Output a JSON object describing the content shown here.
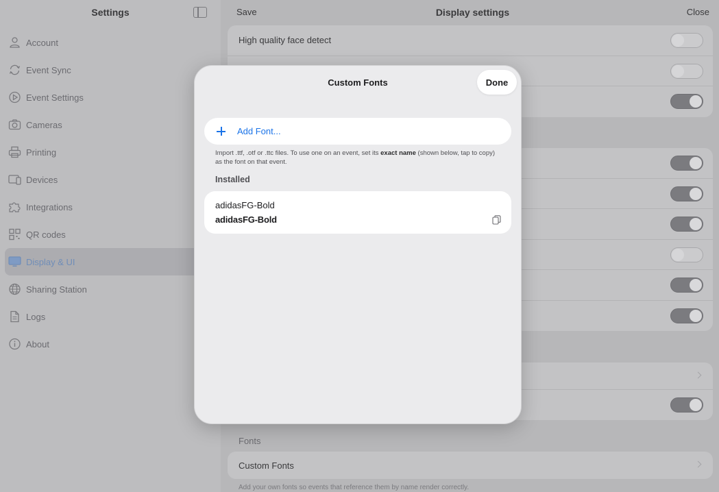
{
  "sidebar": {
    "title": "Settings",
    "items": [
      {
        "label": "Account",
        "icon": "person-icon"
      },
      {
        "label": "Event Sync",
        "icon": "sync-icon"
      },
      {
        "label": "Event Settings",
        "icon": "play-circle-icon"
      },
      {
        "label": "Cameras",
        "icon": "camera-icon"
      },
      {
        "label": "Printing",
        "icon": "printer-icon"
      },
      {
        "label": "Devices",
        "icon": "devices-icon"
      },
      {
        "label": "Integrations",
        "icon": "puzzle-icon"
      },
      {
        "label": "QR codes",
        "icon": "qr-code-icon"
      },
      {
        "label": "Display & UI",
        "icon": "display-icon",
        "selected": true
      },
      {
        "label": "Sharing Station",
        "icon": "globe-icon"
      },
      {
        "label": "Logs",
        "icon": "document-icon"
      },
      {
        "label": "About",
        "icon": "info-icon"
      }
    ]
  },
  "detail": {
    "save_label": "Save",
    "title": "Display settings",
    "close_label": "Close",
    "first_row_label": "High quality face detect",
    "fonts_section_label": "Fonts",
    "custom_fonts_row_label": "Custom Fonts",
    "fonts_footnote": "Add your own fonts so events that reference them by name render correctly."
  },
  "modal": {
    "title": "Custom Fonts",
    "done_label": "Done",
    "add_font_label": "Add Font...",
    "help_text_pre": "Import .ttf, .otf or .ttc files. To use one on an event, set its ",
    "help_text_bold": "exact name",
    "help_text_post": " (shown below, tap to copy) as the font on that event.",
    "installed_label": "Installed",
    "fonts": [
      {
        "name": "adidasFG-Bold",
        "preview": "adidasFG-Bold"
      }
    ]
  },
  "colors": {
    "accent": "#1a73e8",
    "dim_background": "#b7b7b9",
    "modal_background": "#ebebed"
  }
}
